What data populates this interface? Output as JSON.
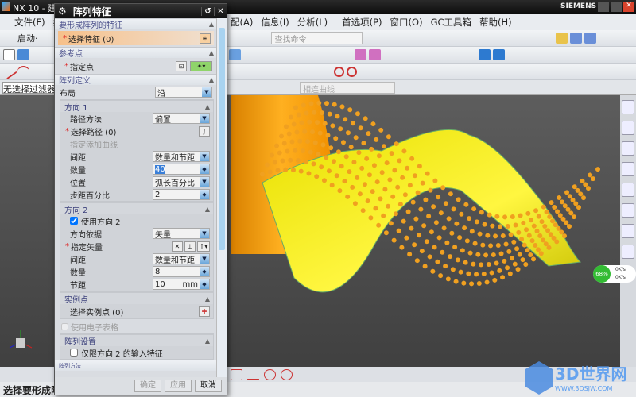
{
  "window": {
    "title": "NX 10 - 建模",
    "brand": "SIEMENS"
  },
  "menu": [
    "文件(F)",
    "编",
    "配(A)",
    "信息(I)",
    "分析(L)",
    "首选项(P)",
    "窗口(O)",
    "GC工具箱",
    "帮助(H)"
  ],
  "toolbar": {
    "start": "启动·",
    "search_placeholder": "查找命令",
    "filter": "无选择过滤器",
    "curve_rule": "相连曲线"
  },
  "dialog": {
    "title": "阵列特征",
    "sections": {
      "features": "要形成阵列的特征",
      "ref_point": "参考点",
      "definition": "阵列定义",
      "dir1": "方向 1",
      "dir2": "方向 2",
      "instance": "实例点",
      "settings": "阵列设置",
      "next": "阵列方法"
    },
    "select_feature": "选择特征 (0)",
    "specify_point": "指定点",
    "layout_label": "布局",
    "layout_value": "沿",
    "dir1": {
      "path_method_label": "路径方法",
      "path_method": "偏置",
      "select_path": "选择路径 (0)",
      "specify_curve": "指定添加曲线",
      "spacing_label": "间距",
      "spacing": "数量和节距",
      "count_label": "数量",
      "count": "40",
      "position_label": "位置",
      "position": "弧长百分比",
      "step_label": "步距百分比",
      "step": "2"
    },
    "dir2": {
      "use_label": "使用方向 2",
      "use": true,
      "direction_label": "方向依据",
      "direction": "矢量",
      "specify_vector": "指定矢量",
      "spacing_label": "间距",
      "spacing": "数量和节距",
      "count_label": "数量",
      "count": "8",
      "pitch_label": "节距",
      "pitch": "10",
      "unit": "mm"
    },
    "select_instance": "选择实例点 (0)",
    "use_spreadsheet": "使用电子表格",
    "only_dir2": "仅限方向 2 的输入特征",
    "buttons": {
      "ok": "确定",
      "apply": "应用",
      "cancel": "取消"
    }
  },
  "status": "选择要形成阵列的特征",
  "perf": {
    "percent": "68%",
    "up": "0K/s",
    "down": "0K/s"
  },
  "watermark": {
    "name": "3D世界网",
    "url": "WWW.3DSJW.COM"
  }
}
